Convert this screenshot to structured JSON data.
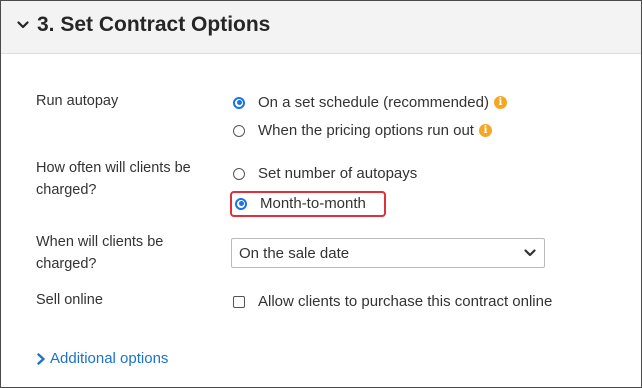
{
  "section": {
    "title": "3. Set Contract Options"
  },
  "fields": {
    "autopay": {
      "label": "Run autopay",
      "options": [
        {
          "label": "On a set schedule (recommended)",
          "selected": true,
          "info_icon": "info-icon"
        },
        {
          "label": "When the pricing options run out",
          "selected": false,
          "info_icon": "info-icon"
        }
      ]
    },
    "frequency": {
      "label": "How often will clients be charged?",
      "options": [
        {
          "label": "Set number of autopays",
          "selected": false
        },
        {
          "label": "Month-to-month",
          "selected": true
        }
      ]
    },
    "charge_date": {
      "label": "When will clients be charged?",
      "selected_value": "On the sale date"
    },
    "sell_online": {
      "label": "Sell online",
      "checkbox_label": "Allow clients to purchase this contract online",
      "checked": false
    }
  },
  "additional_options": {
    "label": "Additional options"
  },
  "colors": {
    "accent": "#1a73e8",
    "info": "#f5a623",
    "highlight": "#e0303a",
    "link": "#1a73c8"
  }
}
